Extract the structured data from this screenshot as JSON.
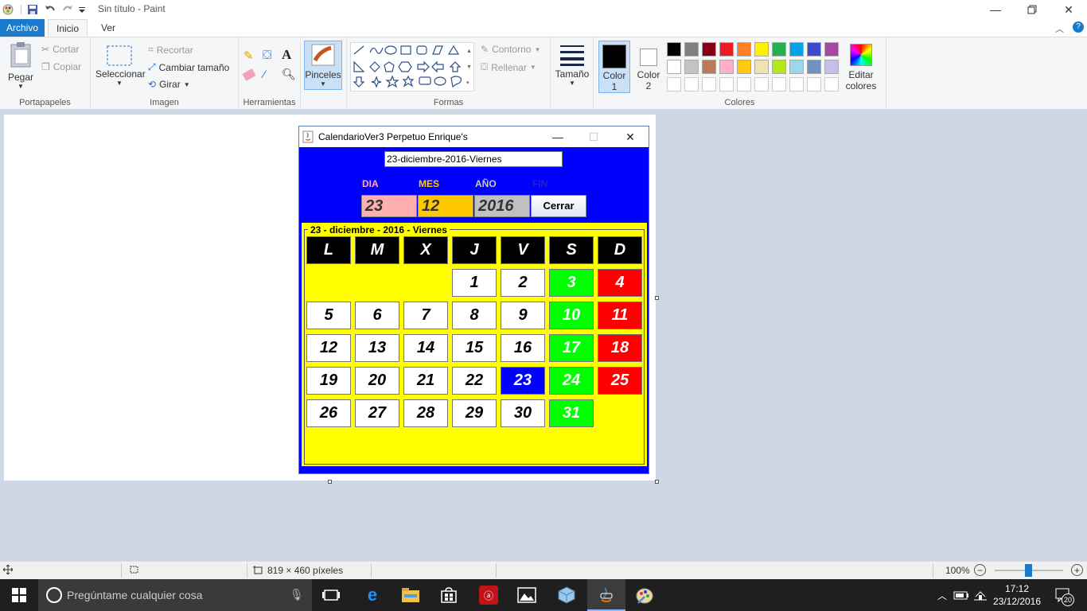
{
  "window": {
    "title": "Sin título - Paint"
  },
  "tabs": [
    {
      "label": "Archivo"
    },
    {
      "label": "Inicio"
    },
    {
      "label": "Ver"
    }
  ],
  "ribbon": {
    "clipboard": {
      "paste": "Pegar",
      "cut": "Cortar",
      "copy": "Copiar",
      "label": "Portapapeles"
    },
    "image": {
      "select": "Seleccionar",
      "crop": "Recortar",
      "resize": "Cambiar tamaño",
      "rotate": "Girar",
      "label": "Imagen"
    },
    "tools": {
      "label": "Herramientas"
    },
    "brushes": {
      "label": "Pinceles"
    },
    "shapes": {
      "outline": "Contorno",
      "fill": "Rellenar",
      "label": "Formas"
    },
    "size": {
      "label": "Tamaño"
    },
    "color1": {
      "label": "Color",
      "num": "1"
    },
    "color2": {
      "label": "Color",
      "num": "2"
    },
    "colors": {
      "label": "Colores"
    },
    "edit_colors": {
      "line1": "Editar",
      "line2": "colores"
    },
    "palette_row1": [
      "#000000",
      "#7f7f7f",
      "#880015",
      "#ed1c24",
      "#ff7f27",
      "#fff200",
      "#22b14c",
      "#00a2e8",
      "#3f48cc",
      "#a349a4"
    ],
    "palette_row2": [
      "#ffffff",
      "#c3c3c3",
      "#b97a57",
      "#ffaec9",
      "#ffc90e",
      "#efe4b0",
      "#b5e61d",
      "#99d9ea",
      "#7092be",
      "#c8bfe7"
    ]
  },
  "java_window": {
    "title": "CalendarioVer3 Perpetuo Enrique's",
    "date_value": "23-diciembre-2016-Viernes",
    "labels": {
      "day": "DIA",
      "month": "MES",
      "year": "AÑO",
      "end": "FIN"
    },
    "day_value": "23",
    "month_value": "12",
    "year_value": "2016",
    "close_button": "Cerrar",
    "calendar_title": "23 - diciembre - 2016 - Viernes",
    "weekdays": [
      "L",
      "M",
      "X",
      "J",
      "V",
      "S",
      "D"
    ],
    "weeks": [
      [
        "",
        "",
        "",
        "1",
        "2",
        "3",
        "4"
      ],
      [
        "5",
        "6",
        "7",
        "8",
        "9",
        "10",
        "11"
      ],
      [
        "12",
        "13",
        "14",
        "15",
        "16",
        "17",
        "18"
      ],
      [
        "19",
        "20",
        "21",
        "22",
        "23",
        "24",
        "25"
      ],
      [
        "26",
        "27",
        "28",
        "29",
        "30",
        "31",
        ""
      ]
    ],
    "selected_day": "23"
  },
  "statusbar": {
    "dimensions": "819 × 460 píxeles",
    "zoom": "100%"
  },
  "taskbar": {
    "search_placeholder": "Pregúntame cualquier cosa",
    "time": "17:12",
    "date": "23/12/2016",
    "notification_count": "20"
  }
}
